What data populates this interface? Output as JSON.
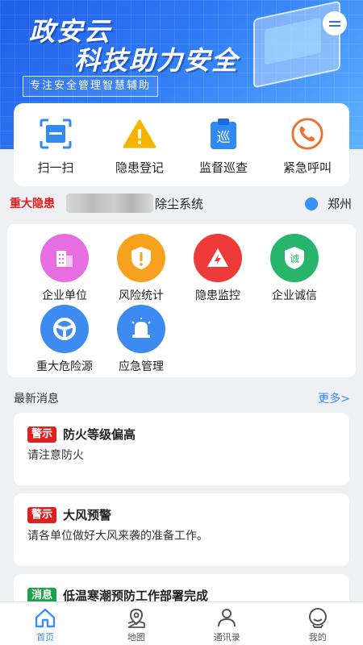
{
  "banner": {
    "title_line1": "政安云",
    "title_line2": "科技助力安全",
    "subtitle": "专注安全管理智慧辅助",
    "message_icon": "chat-bubble-icon"
  },
  "quick_actions": [
    {
      "label": "扫一扫",
      "icon": "scan-icon",
      "color": "#2f8af5"
    },
    {
      "label": "隐患登记",
      "icon": "warning-icon",
      "color": "#f5b400"
    },
    {
      "label": "监督巡查",
      "icon": "patrol-clipboard-icon",
      "color": "#2f8af5"
    },
    {
      "label": "紧急呼叫",
      "icon": "phone-icon",
      "color": "#f07030"
    }
  ],
  "notice": {
    "tag": "重大隐患",
    "text": "除尘系统",
    "city": "郑州"
  },
  "functions": [
    {
      "label": "企业单位",
      "icon": "building-icon",
      "color": "#e76ee0"
    },
    {
      "label": "风险统计",
      "icon": "risk-alert-icon",
      "color": "#f7a21e"
    },
    {
      "label": "隐患监控",
      "icon": "lightning-alarm-icon",
      "color": "#ef3a3a"
    },
    {
      "label": "企业诚信",
      "icon": "shield-integrity-icon",
      "color": "#27b56b"
    },
    {
      "label": "重大危险源",
      "icon": "steering-wheel-icon",
      "color": "#3d8bf0"
    },
    {
      "label": "应急管理",
      "icon": "siren-icon",
      "color": "#3d8bf0"
    }
  ],
  "news": {
    "header": "最新消息",
    "more": "更多>",
    "items": [
      {
        "tag": "警示",
        "tag_color": "#e02020",
        "title": "防火等级偏高",
        "body": "请注意防火"
      },
      {
        "tag": "警示",
        "tag_color": "#e02020",
        "title": "大风预警",
        "body": "请各单位做好大风来袭的准备工作。"
      },
      {
        "tag": "消息",
        "tag_color": "#1aa34a",
        "title": "低温寒潮预防工作部署完成",
        "body": ""
      }
    ]
  },
  "tabs": [
    {
      "label": "首页",
      "icon": "home-icon",
      "active": true
    },
    {
      "label": "地图",
      "icon": "map-pin-icon",
      "active": false
    },
    {
      "label": "通讯录",
      "icon": "contacts-icon",
      "active": false
    },
    {
      "label": "我的",
      "icon": "profile-icon",
      "active": false
    }
  ]
}
